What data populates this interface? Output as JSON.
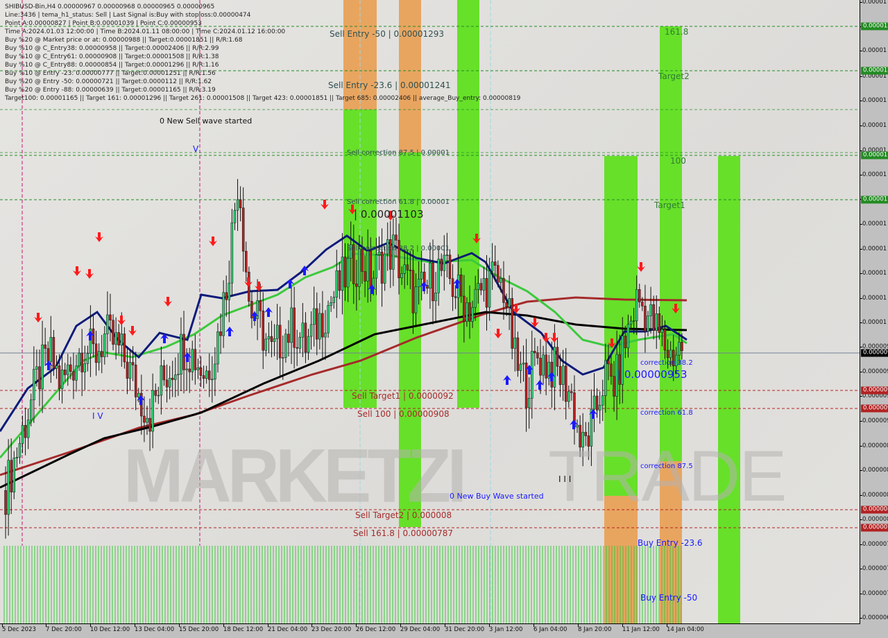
{
  "header": {
    "symbol_line": "SHIBUSD-Bin,H4  0.00000967 0.00000968 0.00000965 0.00000965",
    "info_lines": [
      "Line:3436 | tema_h1_status: Sell | Last Signal is:Buy with stoploss:0.00000474",
      "Point A:0.00000827 | Point B:0.00001039 | Point C:0.00000953",
      "Time A:2024.01.03 12:00:00 | Time B:2024.01.11 08:00:00 | Time C:2024.01.12 16:00:00",
      "Buy %20 @ Market price or at: 0.00000988 || Target:0.00001851 || R/R:1.68",
      "Buy %10 @ C_Entry38: 0.00000958 || Target:0.00002406 || R/R:2.99",
      "Buy %10 @ C_Entry61: 0.00000908 || Target:0.00001508 || R/R:1.38",
      "Buy %10 @ C_Entry88: 0.00000854 || Target:0.00001296 || R/R:1.16",
      "Buy %10 @ Entry -23: 0.00000777 || Target:0.00001251 || R/R:1.56",
      "Buy %20 @ Entry -50: 0.00000721 || Target:0.0000112 || R/R:1.62",
      "Buy %20 @ Entry -88: 0.00000639 || Target:0.00001165 || R/R:3.19",
      "Target100: 0.00001165 || Target 161: 0.00001296 || Target 261: 0.00001508 || Target 423: 0.00001851 || Target 685: 0.00002406 || average_Buy_entry: 0.00000819"
    ]
  },
  "annotations": {
    "sell_entry_50": "Sell Entry -50 | 0.00001293",
    "sell_entry_236": "Sell Entry -23.6 | 0.00001241",
    "sell_corr_875": "Sell correction 87.5 | 0.00001",
    "sell_corr_618": "Sell correction 61.8 | 0.00001",
    "sell_corr_382": "Sell correction 38.2 | 0.00001",
    "point_b_label": "| 0.00001103",
    "point_c_label": "| 0.00000953",
    "new_sell_wave": "0 New Sell wave started",
    "new_buy_wave": "0 New Buy Wave started",
    "sell_target1": "Sell Target1 | 0.0000092",
    "sell_100": "Sell 100 | 0.00000908",
    "sell_target2": "Sell Target2 | 0.000008",
    "sell_1618": "Sell 161.8 | 0.00000787",
    "buy_1618": "161.8",
    "buy_target2": "Target2",
    "buy_100": "100",
    "buy_target1": "Target1",
    "corr_382": "correction 38.2",
    "corr_618": "correction 61.8",
    "corr_875": "correction 87.5",
    "buy_entry_236": "Buy Entry -23.6",
    "buy_entry_50": "Buy Entry -50",
    "wave_iv": "I V",
    "wave_v": "V",
    "wave_iii": "I I I"
  },
  "watermark": {
    "left": "MARKETZI",
    "right": "TRADE"
  },
  "colors": {
    "bg": "#e3e2df",
    "bull": "#2ecc71",
    "bear": "#b22222",
    "ma_fast": "#0d1b7a",
    "ma_mid": "#3cc93c",
    "ma_slow": "#000000",
    "ma_red": "#a52a2a",
    "zone_green": "#5ce01a",
    "zone_orange": "#e8a055",
    "buy_level": "#228b22",
    "sell_level": "#b22222"
  },
  "chart_data": {
    "type": "candlestick",
    "title": "SHIBUSD-Bin,H4",
    "ohlc_last": {
      "open": 9.67e-06,
      "high": 9.68e-06,
      "low": 9.65e-06,
      "close": 9.65e-06
    },
    "ylim": [
      6.3e-06,
      1.3e-05
    ],
    "current_price": 9.65e-06,
    "x_ticks": [
      "5 Dec 2023",
      "7 Dec 20:00",
      "10 Dec 12:00",
      "13 Dec 04:00",
      "15 Dec 20:00",
      "18 Dec 12:00",
      "21 Dec 04:00",
      "23 Dec 20:00",
      "26 Dec 12:00",
      "29 Dec 04:00",
      "31 Dec 20:00",
      "3 Jan 12:00",
      "6 Jan 04:00",
      "8 Jan 20:00",
      "11 Jan 12:00",
      "14 Jan 04:00"
    ],
    "y_tick_labels": [
      "0.00001",
      "0.00001",
      "0.00001",
      "0.00001",
      "0.00001",
      "0.00001",
      "0.00001",
      "0.00001",
      "0.00001",
      "0.00001",
      "0.00001",
      "0.00001",
      "0.00001",
      "0.00001",
      "0.000009",
      "0.000009",
      "0.000009",
      "0.000009",
      "0.000008",
      "0.000008",
      "0.000008",
      "0.000008",
      "0.000007",
      "0.000007",
      "0.000007",
      "0.000006"
    ],
    "buy_levels": [
      {
        "name": "161.8",
        "value": 1.296e-05
      },
      {
        "name": "Target2",
        "value": 1.251e-05
      },
      {
        "name": "100",
        "value": 1.165e-05
      },
      {
        "name": "Target1",
        "value": 1.12e-05
      }
    ],
    "sell_levels": [
      {
        "name": "Sell Target1",
        "value": 9.2e-06
      },
      {
        "name": "Sell 100",
        "value": 9.08e-06
      },
      {
        "name": "Sell Target2",
        "value": 8e-06
      },
      {
        "name": "Sell 161.8",
        "value": 7.87e-06
      }
    ],
    "points": {
      "A": {
        "time": "2024.01.03 12:00:00",
        "price": 8.27e-06
      },
      "B": {
        "time": "2024.01.11 08:00:00",
        "price": 1.039e-05
      },
      "C": {
        "time": "2024.01.12 16:00:00",
        "price": 9.53e-06
      }
    },
    "close_series_approx": [
      8.2e-06,
      8.6e-06,
      9e-06,
      9.4e-06,
      9.6e-06,
      9.3e-06,
      9.5e-06,
      9.7e-06,
      9.6e-06,
      9.8e-06,
      9.7e-06,
      9.5e-06,
      9.2e-06,
      9e-06,
      9.3e-06,
      9.5e-06,
      9.7e-06,
      9.6e-06,
      9.4e-06,
      9.7e-06,
      1.04e-05,
      1.15e-05,
      1.01e-05,
      9.9e-06,
      9.6e-06,
      9.8e-06,
      9.9e-06,
      9.7e-06,
      9.9e-06,
      1.01e-05,
      1.03e-05,
      1.05e-05,
      1.06e-05,
      1.04e-05,
      1.06e-05,
      1.07e-05,
      1.04e-05,
      1.02e-05,
      1.03e-05,
      1.05e-05,
      1.04e-05,
      1.02e-05,
      1.01e-05,
      1.03e-05,
      1.04e-05,
      1.03e-05,
      9.5e-06,
      9.3e-06,
      9.6e-06,
      9.5e-06,
      9.4e-06,
      9.2e-06,
      8.6e-06,
      8.9e-06,
      9.4e-06,
      9.3e-06,
      9.8e-06,
      1.02e-05,
      1e-05,
      9.8e-06,
      9.6e-06,
      9.7e-06
    ]
  }
}
